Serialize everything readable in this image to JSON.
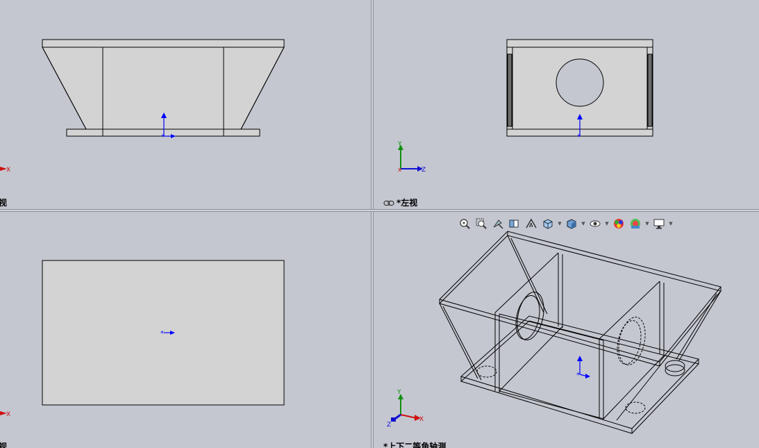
{
  "views": {
    "top_left": {
      "label": "视"
    },
    "top_right": {
      "label": "*左视"
    },
    "bottom_left": {
      "label": "视"
    },
    "bottom_right": {
      "label": "*上下二等角轴测"
    }
  },
  "triad": {
    "x": "X",
    "y": "Y",
    "z": "Z"
  },
  "toolbar": {
    "items": [
      "zoom-to-fit-icon",
      "zoom-to-area-icon",
      "previous-view-icon",
      "section-view-icon",
      "dynamic-annotation-icon",
      "view-orientation-icon",
      "display-style-icon",
      "hide-show-items-icon",
      "edit-appearance-icon",
      "apply-scene-icon",
      "view-settings-icon"
    ]
  },
  "colors": {
    "background": "#c4c7d0",
    "part_fill": "#d3d3d3",
    "edge": "#000000",
    "origin_blue": "#0000ff",
    "axis_x_red": "#d01010",
    "axis_y_green": "#109010"
  }
}
